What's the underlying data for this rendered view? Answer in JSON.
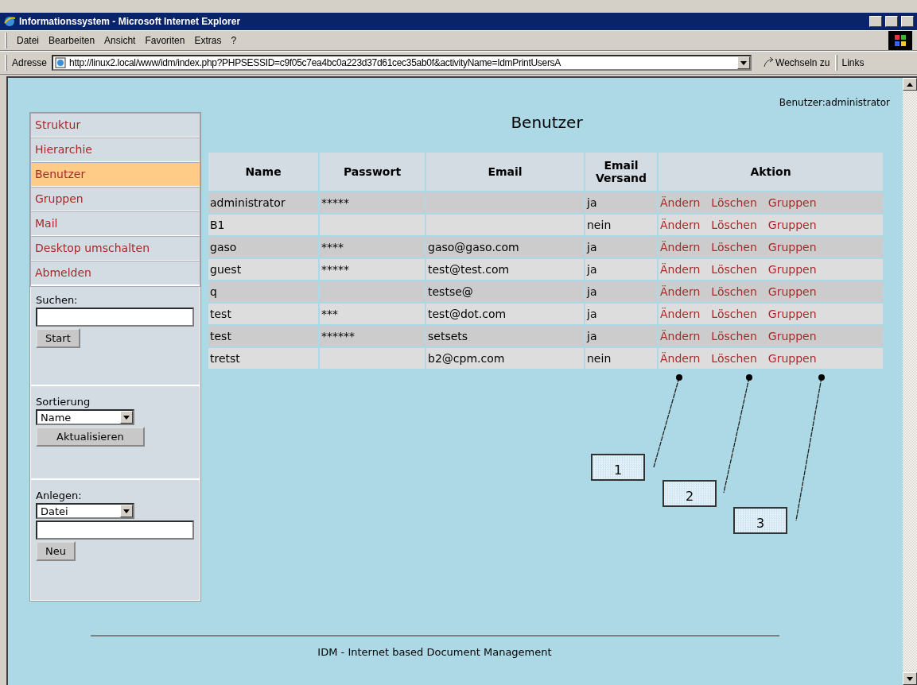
{
  "window": {
    "title": "Informationssystem - Microsoft Internet Explorer"
  },
  "menu": [
    "Datei",
    "Bearbeiten",
    "Ansicht",
    "Favoriten",
    "Extras",
    "?"
  ],
  "address_bar": {
    "label": "Adresse",
    "url": "http://linux2.local/www/idm/index.php?PHPSESSID=c9f05c7ea4bc0a223d37d61cec35ab0f&activityName=IdmPrintUsersA",
    "go": "Wechseln zu",
    "links": "Links"
  },
  "user_info": "Benutzer:administrator",
  "sidebar": {
    "items": [
      {
        "label": "Struktur",
        "selected": false
      },
      {
        "label": "Hierarchie",
        "selected": false
      },
      {
        "label": "Benutzer",
        "selected": true
      },
      {
        "label": "Gruppen",
        "selected": false
      },
      {
        "label": "Mail",
        "selected": false
      },
      {
        "label": "Desktop umschalten",
        "selected": false
      },
      {
        "label": "Abmelden",
        "selected": false
      }
    ],
    "search": {
      "label": "Suchen:",
      "button": "Start"
    },
    "sort": {
      "label": "Sortierung",
      "value": "Name",
      "button": "Aktualisieren"
    },
    "create": {
      "label": "Anlegen:",
      "value": "Datei",
      "button": "Neu"
    }
  },
  "page_title": "Benutzer",
  "table": {
    "columns": [
      "Name",
      "Passwort",
      "Email",
      "Email Versand",
      "Aktion"
    ],
    "rows": [
      {
        "name": "administrator",
        "password": "*****",
        "email": "",
        "versand": "ja",
        "actions": [
          "Ändern",
          "Löschen",
          "Gruppen"
        ]
      },
      {
        "name": "B1",
        "password": "",
        "email": "",
        "versand": "nein",
        "actions": [
          "Ändern",
          "Löschen",
          "Gruppen"
        ]
      },
      {
        "name": "gaso",
        "password": "****",
        "email": "gaso@gaso.com",
        "versand": "ja",
        "actions": [
          "Ändern",
          "Löschen",
          "Gruppen"
        ]
      },
      {
        "name": "guest",
        "password": "*****",
        "email": "test@test.com",
        "versand": "ja",
        "actions": [
          "Ändern",
          "Löschen",
          "Gruppen"
        ]
      },
      {
        "name": "q",
        "password": "",
        "email": "testse@",
        "versand": "ja",
        "actions": [
          "Ändern",
          "Löschen",
          "Gruppen"
        ]
      },
      {
        "name": "test",
        "password": "***",
        "email": "test@dot.com",
        "versand": "ja",
        "actions": [
          "Ändern",
          "Löschen",
          "Gruppen"
        ]
      },
      {
        "name": "test",
        "password": "******",
        "email": "setsets",
        "versand": "ja",
        "actions": [
          "Ändern",
          "Löschen",
          "Gruppen"
        ]
      },
      {
        "name": "tretst",
        "password": "",
        "email": "b2@cpm.com",
        "versand": "nein",
        "actions": [
          "Ändern",
          "Löschen",
          "Gruppen"
        ]
      }
    ]
  },
  "callouts": [
    "1",
    "2",
    "3"
  ],
  "footer": "IDM - Internet based Document Management"
}
